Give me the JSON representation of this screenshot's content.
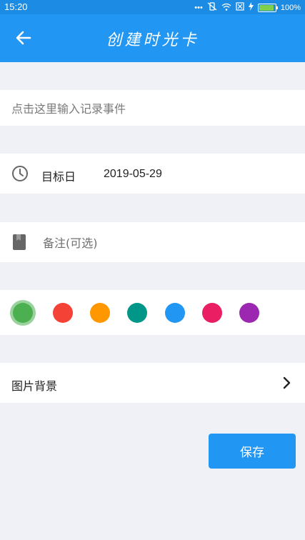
{
  "status_bar": {
    "time": "15:20",
    "battery_text": "100%",
    "battery_level": 1.0,
    "icons": [
      "more-dots-icon",
      "mute-vibrate-icon",
      "wifi-icon",
      "no-sim-icon",
      "charging-icon",
      "battery-icon"
    ]
  },
  "app_bar": {
    "title": "创建时光卡",
    "back_icon": "arrow-left-icon"
  },
  "event": {
    "placeholder": "点击这里输入记录事件",
    "value": ""
  },
  "date": {
    "label": "目标日",
    "value": "2019-05-29",
    "icon": "clock-icon"
  },
  "note": {
    "placeholder": "备注(可选)",
    "value": "",
    "icon": "bookmark-icon"
  },
  "colors": {
    "selected_index": 0,
    "options": [
      {
        "name": "green",
        "hex": "#4caf50"
      },
      {
        "name": "red",
        "hex": "#f44336"
      },
      {
        "name": "orange",
        "hex": "#ff9800"
      },
      {
        "name": "teal",
        "hex": "#009688"
      },
      {
        "name": "blue",
        "hex": "#2196f3"
      },
      {
        "name": "pink",
        "hex": "#e91e63"
      },
      {
        "name": "purple",
        "hex": "#9c27b0"
      }
    ]
  },
  "background": {
    "label": "图片背景",
    "icon": "chevron-right-icon"
  },
  "save_button": {
    "label": "保存"
  },
  "theme": {
    "primary": "#2196f3",
    "status_bar": "#1c8be4",
    "page_background": "#f0f1f6"
  }
}
